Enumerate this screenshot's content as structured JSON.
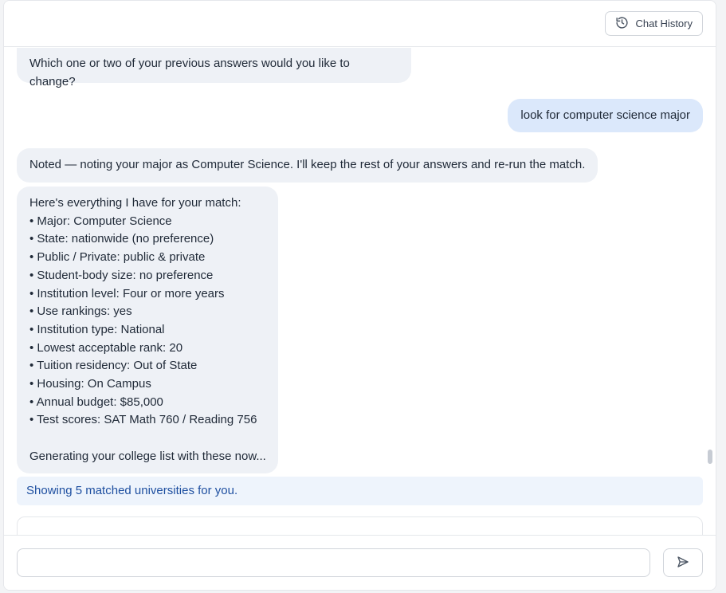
{
  "header": {
    "chat_history_label": "Chat History",
    "chat_history_icon": "history-icon"
  },
  "messages": {
    "bot_question": "Which one or two of your previous answers would you like to change?",
    "user_reply": "look for computer science major",
    "bot_ack": "Noted — noting your major as Computer Science. I'll keep the rest of your answers and re-run the match.",
    "summary": {
      "intro": "Here's everything I have for your match:",
      "items": [
        "• Major: Computer Science",
        "• State: nationwide (no preference)",
        "• Public / Private: public & private",
        "• Student-body size: no preference",
        "• Institution level: Four or more years",
        "• Use rankings: yes",
        "• Institution type: National",
        "• Lowest acceptable rank: 20",
        "• Tuition residency: Out of State",
        "• Housing: On Campus",
        "• Annual budget: $85,000",
        "• Test scores: SAT Math 760 / Reading 756"
      ],
      "footer": "Generating your college list with these now..."
    }
  },
  "status": {
    "matched_text": "Showing 5 matched universities for you."
  },
  "composer": {
    "input_value": "",
    "input_placeholder": "",
    "send_icon": "send-icon"
  }
}
